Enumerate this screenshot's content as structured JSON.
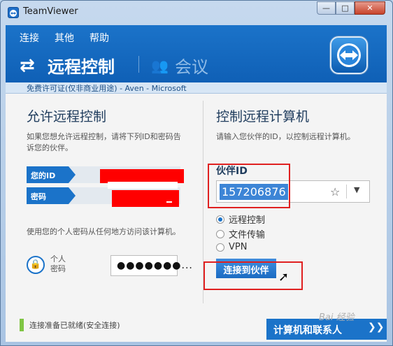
{
  "window": {
    "title": "TeamViewer",
    "minimize": "—",
    "maximize": "□",
    "close": "✕"
  },
  "menu": {
    "items": [
      "连接",
      "其他",
      "帮助"
    ]
  },
  "nav": {
    "remote_label": "远程控制",
    "meeting_label": "会议"
  },
  "license": {
    "text": "免费许可证(仅非商业用途) - Aven - Microsoft"
  },
  "left_panel": {
    "title": "允许远程控制",
    "description": "如果您想允许远程控制，请将下列ID和密码告诉您的伙伴。",
    "id_label": "您的ID",
    "password_label": "密码",
    "personal_desc": "使用您的个人密码从任何地方访问该计算机。",
    "personal_pw_label_1": "个人",
    "personal_pw_label_2": "密码",
    "personal_pw_value": "●●●●●●●..."
  },
  "right_panel": {
    "title": "控制远程计算机",
    "description": "请输入您伙伴的ID，以控制远程计算机。",
    "partner_id_label": "伙伴ID",
    "partner_id_value": "157206876",
    "options": [
      "远程控制",
      "文件传输",
      "VPN"
    ],
    "selected_option": "远程控制",
    "connect_button": "连接到伙伴"
  },
  "footer": {
    "status": "连接准备已就绪(安全连接)",
    "contacts_button": "计算机和联系人"
  },
  "colors": {
    "accent": "#1b73c9",
    "status_ok": "#7fc544",
    "highlight": "#e02020",
    "redaction": "#ff0000"
  }
}
